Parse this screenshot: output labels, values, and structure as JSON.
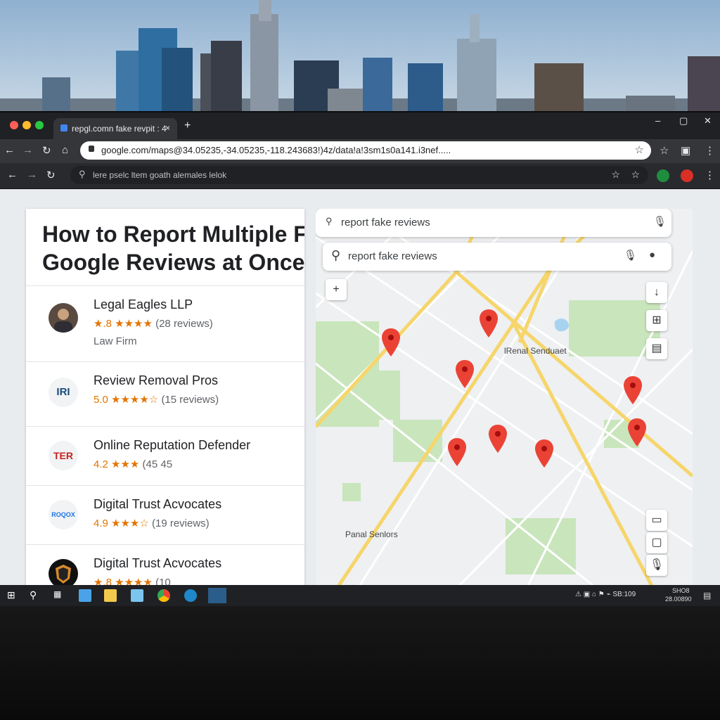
{
  "browser": {
    "tab_title": "repgl.comn fake revpit : 4",
    "tab_close": "×",
    "new_tab": "+",
    "url": "google.com/maps@34.05235,-34.05235,-118.243683!)4z/data!a!3sm1s0a141.i3nef.....",
    "url2": "lere pselc ltem goath alemales lelok",
    "win_min": "–",
    "win_max": "▢",
    "win_close": "✕"
  },
  "article": {
    "title": "How to Report Multiple Fake Google Reviews at Once"
  },
  "results": [
    {
      "name": "Legal Eagles LLP",
      "rating": "★.8 ★★★★",
      "count": "(28 reviews)",
      "type": "Law Firm",
      "avatar": "portrait"
    },
    {
      "name": "Review Removal Pros",
      "rating": "5.0 ★★★★☆",
      "count": "(15 reviews)",
      "type": "",
      "avatar": "IRI"
    },
    {
      "name": "Online Reputation Defender",
      "rating": "4.2 ★★★",
      "count": "(45 45",
      "type": "",
      "avatar": "TER"
    },
    {
      "name": "Digital Trust Acvocates",
      "rating": "4.9 ★★★☆",
      "count": "(19 reviews)",
      "type": "",
      "avatar": "ROQOX"
    },
    {
      "name": "Digital Trust Acvocates",
      "rating": "★.8 ★★★★",
      "count": "(10",
      "type": "",
      "avatar": "shield"
    }
  ],
  "map": {
    "search_top": "report fake reviews",
    "search_main": "report fake reviews",
    "label_center": "lRenal Senduaet",
    "label_bottom": "Panal Senlors",
    "zoom_in": "+"
  },
  "taskbar": {
    "tray_left": "⚠ ▣ ⌂ ⚑ ⌁ SB:109",
    "time": "SHO8",
    "date": "28.00890"
  },
  "colors": {
    "accent": "#1a73e8",
    "pin": "#ea4335",
    "star": "#f29900",
    "road": "#f6d56a",
    "park": "#c9e5bc"
  }
}
